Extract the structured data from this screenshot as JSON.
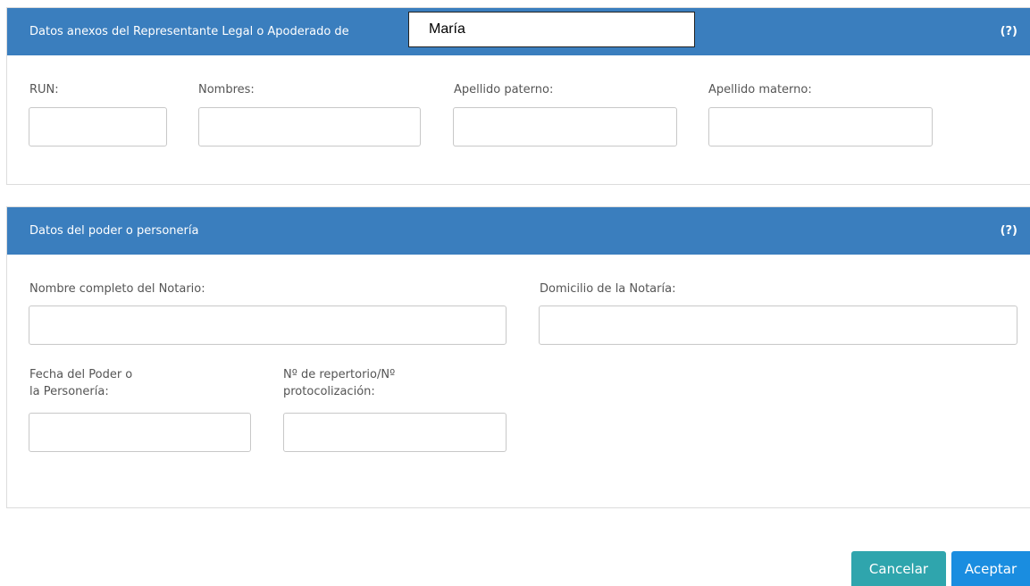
{
  "section_representante": {
    "title": "Datos anexos del Representante Legal o Apoderado de",
    "help": "(?)",
    "fields": {
      "run": {
        "label": "RUN:",
        "value": ""
      },
      "nombres": {
        "label": "Nombres:",
        "value": ""
      },
      "apellido_paterno": {
        "label": "Apellido paterno:",
        "value": ""
      },
      "apellido_materno": {
        "label": "Apellido materno:",
        "value": ""
      }
    }
  },
  "overlay_field": {
    "value": "María"
  },
  "section_poder": {
    "title": "Datos del poder o personería",
    "help": "(?)",
    "fields": {
      "notario": {
        "label": "Nombre completo del Notario:",
        "value": ""
      },
      "domicilio": {
        "label": "Domicilio de la Notaría:",
        "value": ""
      },
      "fecha_line1": "Fecha del Poder o",
      "fecha_line2": "la Personería:",
      "fecha_value": "",
      "repertorio_line1": "Nº de repertorio/Nº",
      "repertorio_line2": "protocolización:",
      "repertorio_value": ""
    }
  },
  "actions": {
    "cancel_label": "Cancelar",
    "accept_label": "Aceptar"
  },
  "colors": {
    "header_bg": "#3a7ebe",
    "cancel_bg": "#2fa5ad",
    "accept_bg": "#1a8de0"
  }
}
